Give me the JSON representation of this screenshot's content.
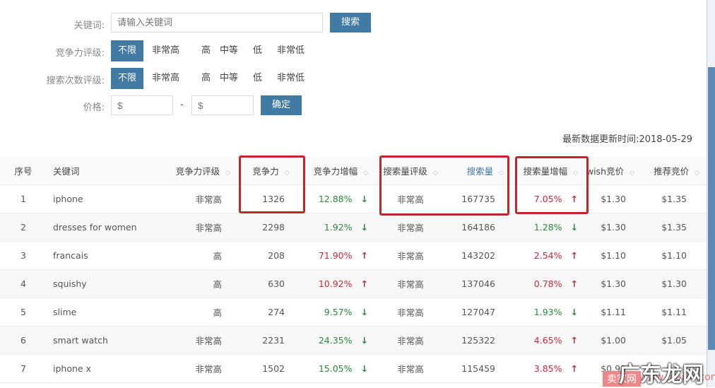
{
  "filters": {
    "keyword_label": "关键词:",
    "keyword_placeholder": "请输入关键词",
    "search_button": "搜索",
    "competition_label": "竞争力评级:",
    "search_count_label": "搜索次数评级:",
    "options": [
      "不限",
      "非常高",
      "高",
      "中等",
      "低",
      "非常低"
    ],
    "price_label": "价格:",
    "price_min_placeholder": "$",
    "price_max_placeholder": "$",
    "price_separator": "-",
    "confirm_button": "确定"
  },
  "update_time": "最新数据更新时间:2018-05-29",
  "table": {
    "headers": [
      "序号",
      "关键词",
      "竞争力评级",
      "竞争力",
      "竞争力增幅",
      "搜索量评级",
      "搜索量",
      "搜索量增幅",
      "wish竞价",
      "推荐竞价"
    ],
    "rows": [
      {
        "idx": "1",
        "kw": "iphone",
        "crate": "非常高",
        "comp": "1326",
        "cgrow": "12.88%",
        "cdir": "down",
        "srate": "非常高",
        "svol": "167735",
        "sgrow": "7.05%",
        "sdir": "up",
        "wish": "$1.30",
        "rec": "$1.35"
      },
      {
        "idx": "2",
        "kw": "dresses for women",
        "crate": "非常高",
        "comp": "2298",
        "cgrow": "1.92%",
        "cdir": "down",
        "srate": "非常高",
        "svol": "164186",
        "sgrow": "1.28%",
        "sdir": "down",
        "wish": "$1.30",
        "rec": "$1.35"
      },
      {
        "idx": "3",
        "kw": "francais",
        "crate": "高",
        "comp": "208",
        "cgrow": "71.90%",
        "cdir": "up",
        "srate": "非常高",
        "svol": "143202",
        "sgrow": "2.54%",
        "sdir": "up",
        "wish": "$1.10",
        "rec": "$1.10"
      },
      {
        "idx": "4",
        "kw": "squishy",
        "crate": "高",
        "comp": "630",
        "cgrow": "10.92%",
        "cdir": "up",
        "srate": "非常高",
        "svol": "137046",
        "sgrow": "0.78%",
        "sdir": "up",
        "wish": "$1.30",
        "rec": "$1.30"
      },
      {
        "idx": "5",
        "kw": "slime",
        "crate": "高",
        "comp": "274",
        "cgrow": "9.57%",
        "cdir": "down",
        "srate": "非常高",
        "svol": "127047",
        "sgrow": "1.93%",
        "sdir": "down",
        "wish": "$1.11",
        "rec": "$1.11"
      },
      {
        "idx": "6",
        "kw": "smart watch",
        "crate": "非常高",
        "comp": "2231",
        "cgrow": "24.35%",
        "cdir": "down",
        "srate": "非常高",
        "svol": "125322",
        "sgrow": "4.65%",
        "sdir": "up",
        "wish": "$1.00",
        "rec": "$1.05"
      },
      {
        "idx": "7",
        "kw": "iphone x",
        "crate": "非常高",
        "comp": "1502",
        "cgrow": "15.05%",
        "cdir": "down",
        "srate": "非常高",
        "svol": "115459",
        "sgrow": "3.85%",
        "sdir": "up",
        "wish": "$0.98",
        "rec": ""
      }
    ]
  },
  "watermark": {
    "main": "广东龙网",
    "tag": "卖家网",
    "url": "www.maijia.com"
  },
  "colors": {
    "accent": "#417aa3",
    "up": "#c8283c",
    "down": "#2a8a3a"
  }
}
